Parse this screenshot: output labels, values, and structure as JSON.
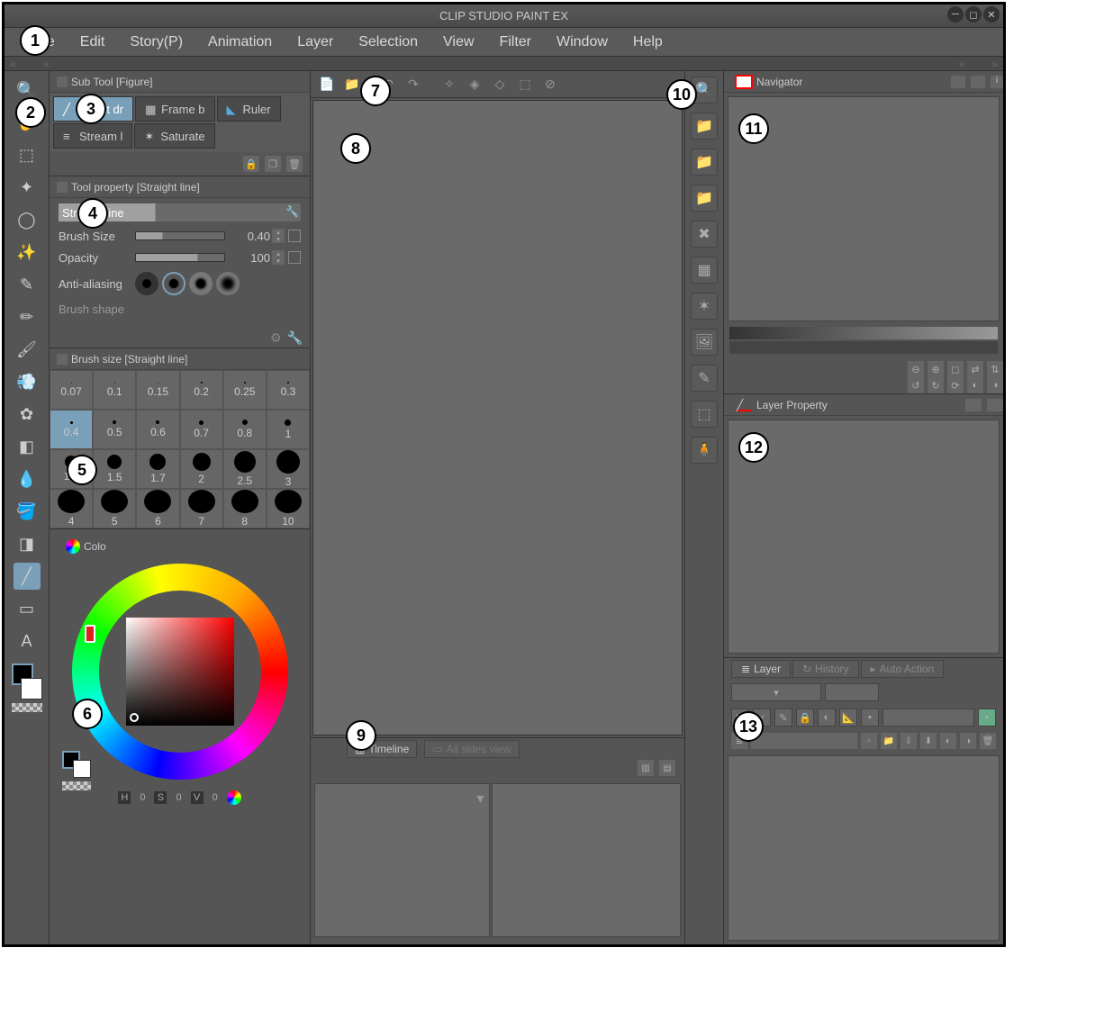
{
  "window": {
    "title": "CLIP STUDIO PAINT EX"
  },
  "menu": [
    "File",
    "Edit",
    "Story(P)",
    "Animation",
    "Layer",
    "Selection",
    "View",
    "Filter",
    "Window",
    "Help"
  ],
  "subtool": {
    "header": "Sub Tool [Figure]",
    "tabs": [
      {
        "label": "Direct dr",
        "selected": true
      },
      {
        "label": "Frame b",
        "selected": false
      },
      {
        "label": "Ruler",
        "selected": false
      },
      {
        "label": "Stream l",
        "selected": false
      },
      {
        "label": "Saturate",
        "selected": false
      }
    ]
  },
  "toolprop": {
    "header": "Tool property [Straight line]",
    "name": "Straight line",
    "rows": {
      "brushSize": {
        "label": "Brush Size",
        "value": "0.40"
      },
      "opacity": {
        "label": "Opacity",
        "value": "100"
      },
      "aa": {
        "label": "Anti-aliasing"
      },
      "brushShape": {
        "label": "Brush shape"
      }
    }
  },
  "brushSize": {
    "header": "Brush size [Straight line]",
    "sizes": [
      [
        "0.07",
        "0.1",
        "0.15",
        "0.2",
        "0.25",
        "0.3"
      ],
      [
        "0.4",
        "0.5",
        "0.6",
        "0.7",
        "0.8",
        "1"
      ],
      [
        "1.2",
        "1.5",
        "1.7",
        "2",
        "2.5",
        "3"
      ],
      [
        "4",
        "5",
        "6",
        "7",
        "8",
        "10"
      ]
    ],
    "selected": "0.4"
  },
  "color": {
    "header": "Colo",
    "h": "0",
    "s": "0",
    "v": "0"
  },
  "timeline": {
    "tab1": "Timeline",
    "tab2": "All sides view"
  },
  "navigator": {
    "header": "Navigator"
  },
  "layerProp": {
    "header": "Layer Property"
  },
  "layer": {
    "tabs": [
      "Layer",
      "History",
      "Auto Action"
    ]
  },
  "callouts": {
    "1": "1",
    "2": "2",
    "3": "3",
    "4": "4",
    "5": "5",
    "6": "6",
    "7": "7",
    "8": "8",
    "9": "9",
    "10": "10",
    "11": "11",
    "12": "12",
    "13": "13"
  }
}
